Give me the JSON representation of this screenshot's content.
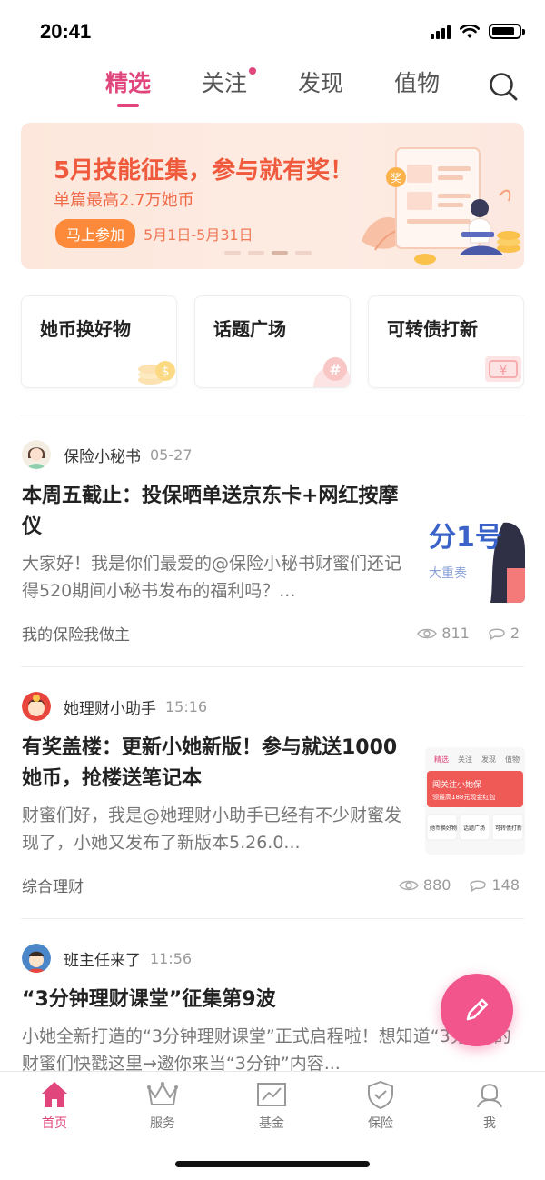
{
  "status_bar": {
    "time": "20:41"
  },
  "top_tabs": [
    {
      "label": "精选",
      "active": true
    },
    {
      "label": "关注",
      "badge": true
    },
    {
      "label": "发现"
    },
    {
      "label": "值物"
    }
  ],
  "banner": {
    "title": "5月技能征集，参与就有奖！",
    "subtitle": "单篇最高2.7万她币",
    "button": "马上参加",
    "date": "5月1日-5月31日",
    "art_badge": "奖"
  },
  "quick_cards": [
    {
      "label": "她币换好物",
      "icon": "coin-icon"
    },
    {
      "label": "话题广场",
      "icon": "hash-icon"
    },
    {
      "label": "可转债打新",
      "icon": "yen-ticket-icon"
    }
  ],
  "posts": [
    {
      "author": "保险小秘书",
      "time": "05-27",
      "title": "本周五截止：投保晒单送京东卡+网红按摩仪",
      "excerpt": "大家好！我是你们最爱的@保险小秘书财蜜们还记得520期间小秘书发布的福利吗？...",
      "tag": "我的保险我做主",
      "views": "811",
      "comments": "2",
      "thumb_text": "分1号",
      "thumb_sub": "大重奏"
    },
    {
      "author": "她理财小助手",
      "time": "15:16",
      "title": "有奖盖楼：更新小她新版！参与就送1000她币，抢楼送笔记本",
      "excerpt": "财蜜们好，我是@她理财小助手已经有不少财蜜发现了，小她又发布了新版本5.26.0...",
      "tag": "综合理财",
      "views": "880",
      "comments": "148",
      "thumb_tabs": [
        "精选",
        "关注",
        "发现",
        "值物"
      ],
      "thumb_banner": "闯关注小她保",
      "thumb_banner_sub": "领最高188元现金红包",
      "thumb_cards": [
        "她币换好物",
        "话题广场",
        "可转债打新"
      ]
    },
    {
      "author": "班主任来了",
      "time": "11:56",
      "title": "“3分钟理财课堂”征集第9波",
      "excerpt": "小她全新打造的“3分钟理财课堂”正式启程啦！想知道“3分钟”的财蜜们快戳这里→邀你来当“3分钟”内容..."
    }
  ],
  "bottom_nav": [
    {
      "label": "首页",
      "icon": "home-icon",
      "active": true
    },
    {
      "label": "服务",
      "icon": "crown-icon"
    },
    {
      "label": "基金",
      "icon": "chart-icon"
    },
    {
      "label": "保险",
      "icon": "shield-icon"
    },
    {
      "label": "我",
      "icon": "profile-icon"
    }
  ],
  "colors": {
    "accent": "#e0457b",
    "fab": "#f2558c",
    "banner_text": "#f05a3c"
  }
}
